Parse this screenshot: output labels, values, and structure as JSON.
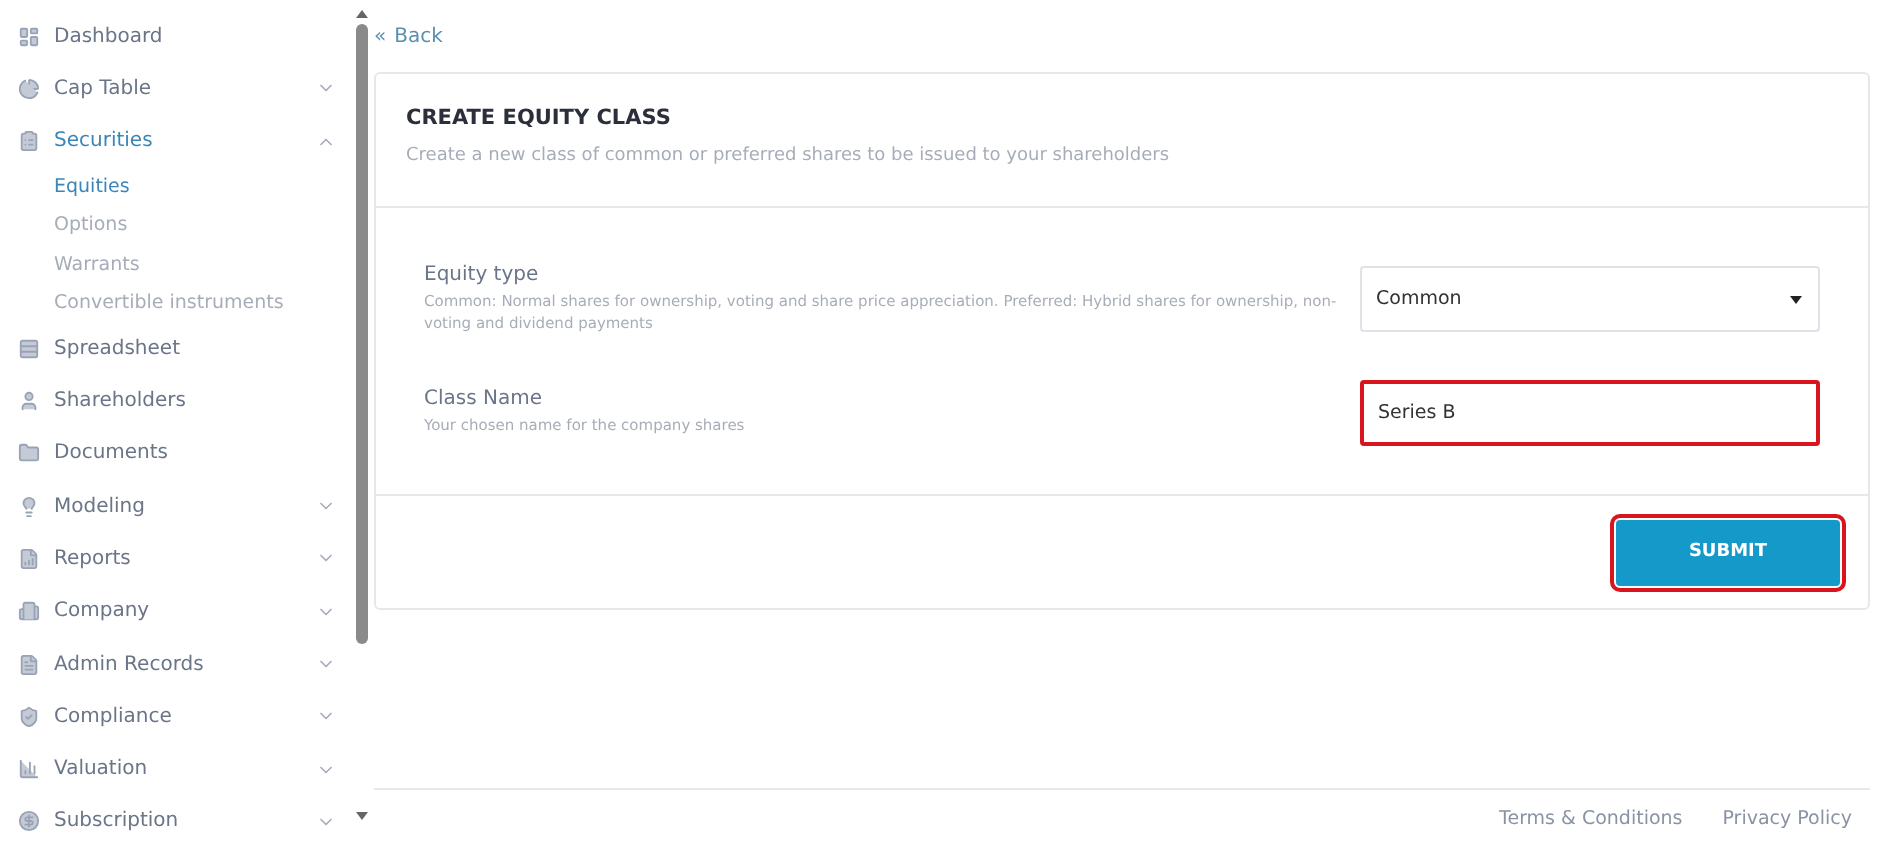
{
  "sidebar": {
    "items": [
      {
        "label": "Dashboard",
        "selected": false
      },
      {
        "label": "Cap Table",
        "selected": false,
        "expanded": false
      },
      {
        "label": "Securities",
        "selected": true,
        "expanded": true,
        "children": [
          {
            "label": "Equities",
            "selected": true
          },
          {
            "label": "Options",
            "selected": false
          },
          {
            "label": "Warrants",
            "selected": false
          },
          {
            "label": "Convertible instruments",
            "selected": false
          }
        ]
      },
      {
        "label": "Spreadsheet",
        "selected": false
      },
      {
        "label": "Shareholders",
        "selected": false
      },
      {
        "label": "Documents",
        "selected": false
      },
      {
        "label": "Modeling",
        "selected": false,
        "expanded": false
      },
      {
        "label": "Reports",
        "selected": false,
        "expanded": false
      },
      {
        "label": "Company",
        "selected": false,
        "expanded": false
      },
      {
        "label": "Admin Records",
        "selected": false,
        "expanded": false
      },
      {
        "label": "Compliance",
        "selected": false,
        "expanded": false
      },
      {
        "label": "Valuation",
        "selected": false,
        "expanded": false
      },
      {
        "label": "Subscription",
        "selected": false,
        "expanded": false
      }
    ]
  },
  "back": {
    "icon": "«",
    "label": "Back"
  },
  "form": {
    "title": "CREATE EQUITY CLASS",
    "subtitle": "Create a new class of common or preferred shares to be issued to your shareholders",
    "fields": [
      {
        "kind": "select",
        "label": "Equity type",
        "hint": "Common: Normal shares for ownership, voting and share price appreciation. Preferred: Hybrid shares for ownership, non-voting and dividend payments",
        "value": "Common",
        "highlighted": false
      },
      {
        "kind": "text",
        "label": "Class Name",
        "hint": "Your chosen name for the company shares",
        "value": "Series B",
        "highlighted": true
      }
    ],
    "submit": {
      "label": "SUBMIT",
      "highlighted": true
    }
  },
  "footer": {
    "links": [
      "Terms & Conditions",
      "Privacy Policy"
    ]
  }
}
